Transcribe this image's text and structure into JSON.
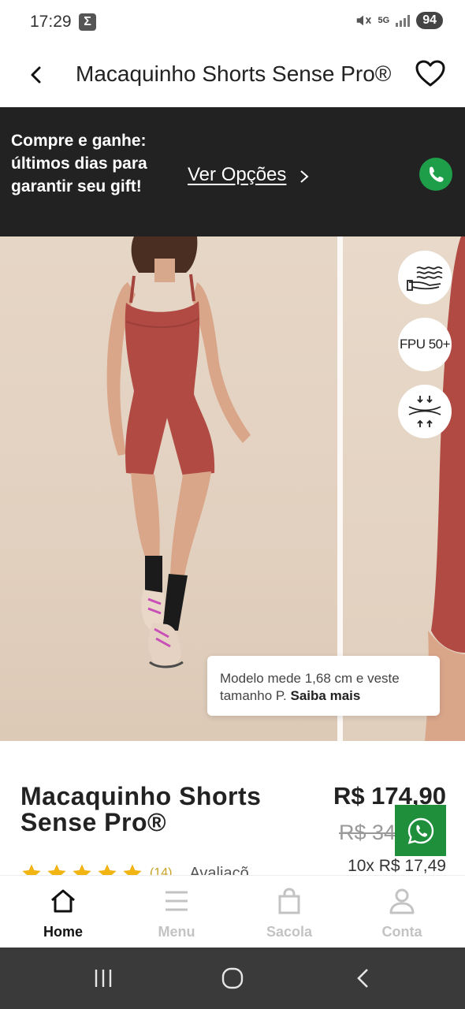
{
  "status_bar": {
    "time": "17:29",
    "app_icon": "Σ",
    "network": "5G",
    "battery": "94"
  },
  "header": {
    "title": "Macaquinho Shorts Sense Pro®"
  },
  "promo": {
    "text": "Compre e ganhe: últimos dias para garantir seu gift!",
    "link": "Ver Opções"
  },
  "gallery": {
    "features": [
      {
        "icon": "fabric-touch-icon"
      },
      {
        "label": "FPU 50+"
      },
      {
        "icon": "compression-icon"
      }
    ],
    "model_note": "Modelo mede 1,68 cm e veste tamanho P.",
    "model_note_link": "Saiba mais"
  },
  "product": {
    "name": "Macaquinho Shorts Sense Pro®",
    "price": "R$ 174,90",
    "old_price": "R$ 34",
    "installments": "10x R$ 17,49",
    "rating_count": "(14)",
    "rating_label": "Avaliaçõ",
    "rating_stars": 5
  },
  "nav": {
    "items": [
      {
        "label": "Home"
      },
      {
        "label": "Menu"
      },
      {
        "label": "Sacola"
      },
      {
        "label": "Conta"
      }
    ]
  },
  "colors": {
    "banner": "#222222",
    "whatsapp": "#1f8f3c",
    "garment": "#b04a43",
    "star": "#f2b413"
  }
}
